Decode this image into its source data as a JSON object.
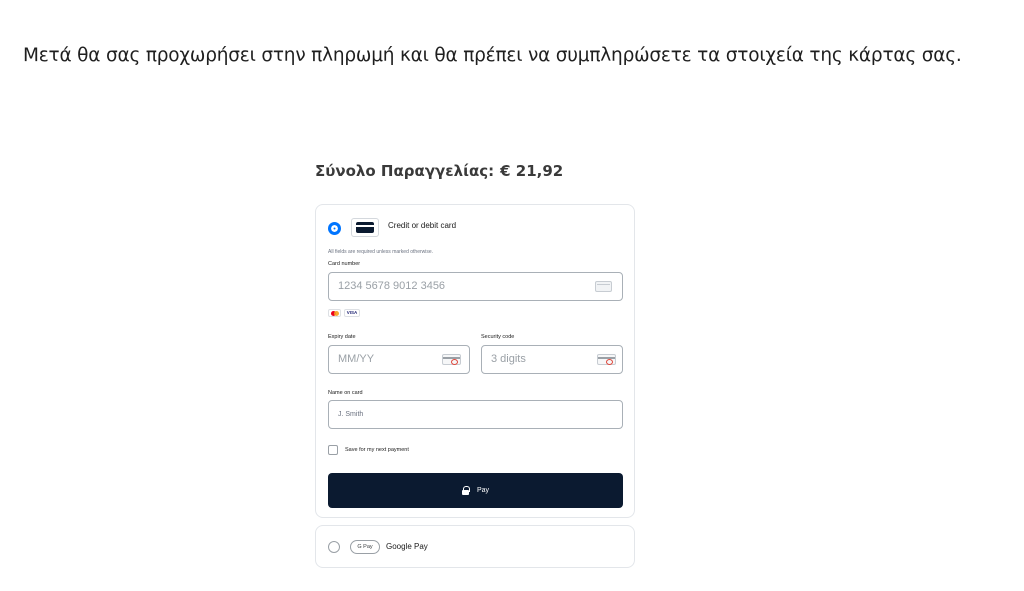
{
  "intro_text": "Μετά θα σας προχωρήσει στην πληρωμή και θα πρέπει να συμπληρώσετε τα στοιχεία της κάρτας σας.",
  "order": {
    "label": "Σύνολο Παραγγελίας:",
    "amount": "€ 21,92"
  },
  "card_method": {
    "label": "Credit or debit card",
    "selected": true,
    "note": "All fields are required unless marked otherwise.",
    "card_number": {
      "label": "Card number",
      "placeholder": "1234 5678 9012 3456"
    },
    "brands": [
      "mastercard",
      "VISA"
    ],
    "expiry": {
      "label": "Expiry date",
      "placeholder": "MM/YY"
    },
    "security": {
      "label": "Security code",
      "placeholder": "3 digits"
    },
    "name": {
      "label": "Name on card",
      "placeholder": "J. Smith"
    },
    "save_label": "Save for my next payment",
    "save_checked": false,
    "pay_label": "Pay"
  },
  "gpay_method": {
    "badge": "G Pay",
    "label": "Google Pay",
    "selected": false
  },
  "colors": {
    "accent": "#0075ff",
    "pay_button": "#0b1a30"
  }
}
